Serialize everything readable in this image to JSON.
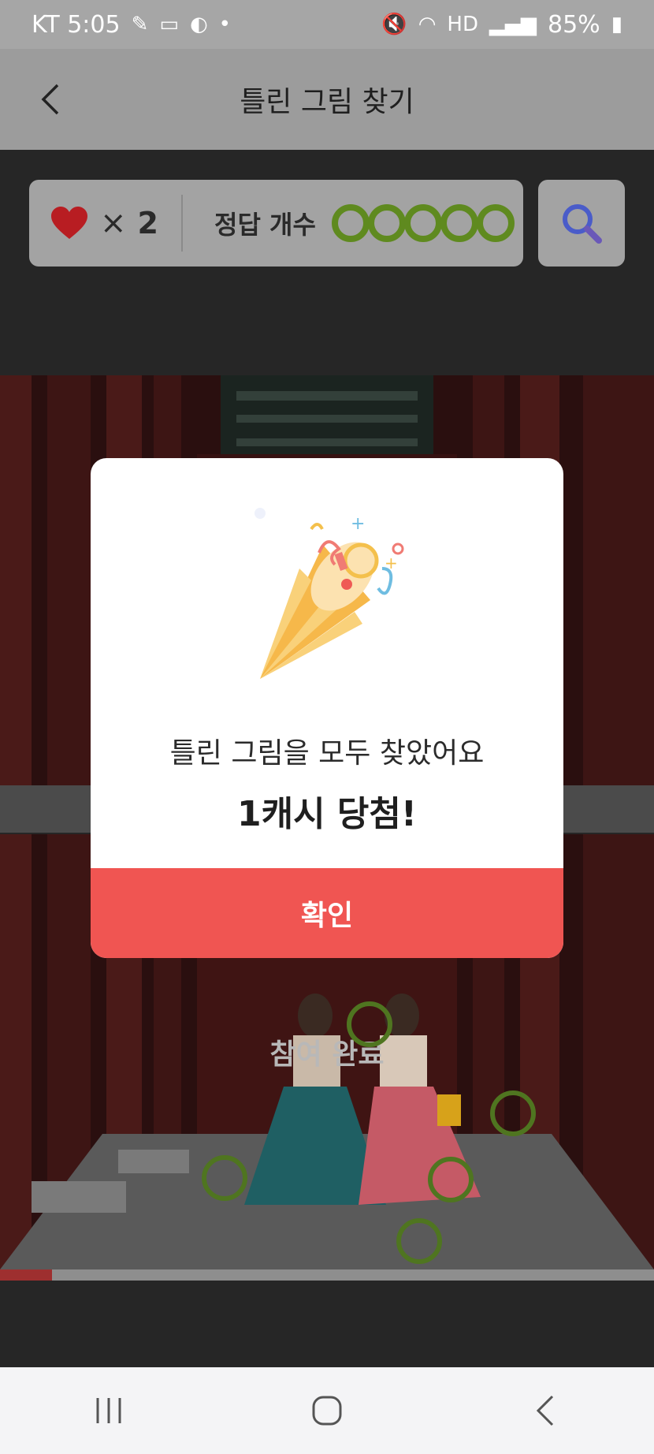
{
  "status_bar": {
    "carrier_time": "KT 5:05",
    "battery": "85%"
  },
  "header": {
    "title": "틀린 그림 찾기"
  },
  "game_info": {
    "lives_multiplier": "×",
    "lives_count": "2",
    "answers_label": "정답 개수",
    "answers_found": 5,
    "answers_total": 5
  },
  "photo": {
    "status_text": "참여 완료",
    "progress": 0.08
  },
  "modal": {
    "message": "틀린 그림을 모두 찾았어요",
    "reward": "1캐시 당첨!",
    "confirm_label": "확인"
  },
  "colors": {
    "accent_red": "#f05552",
    "found_green": "#5f8a1f",
    "hint_blue": "#4a5cc9"
  }
}
